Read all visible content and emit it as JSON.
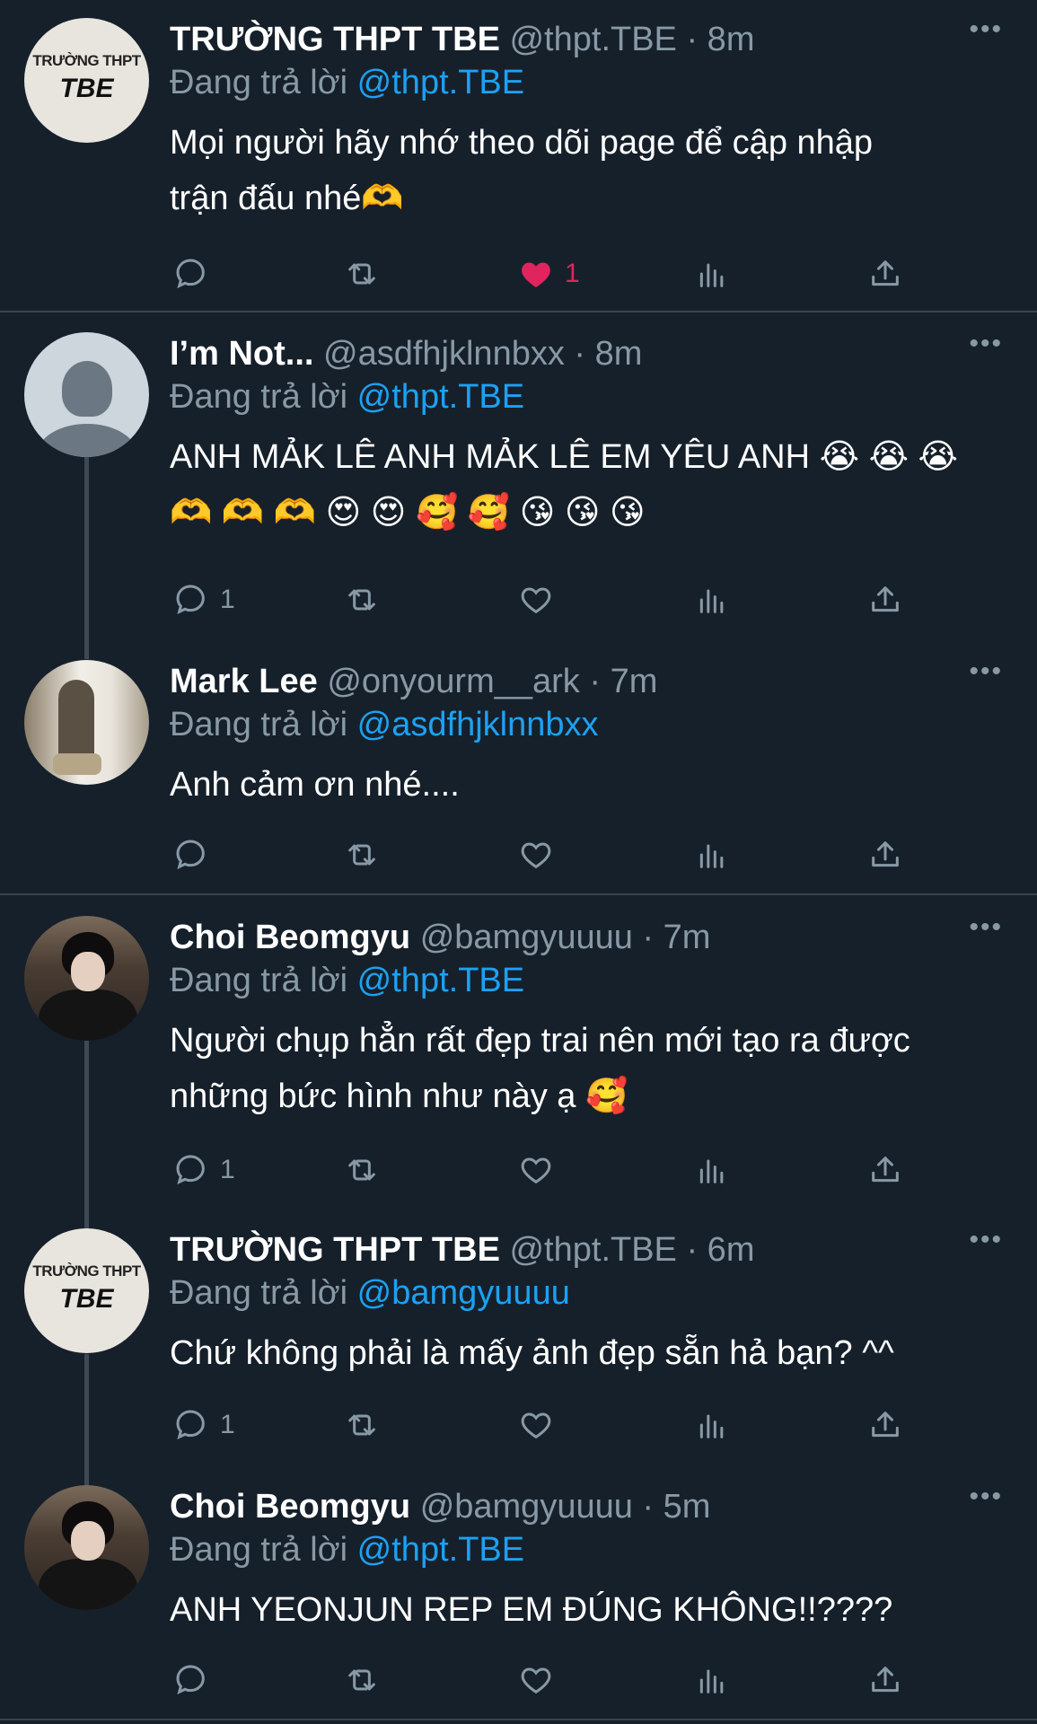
{
  "colors": {
    "background": "#16202b",
    "text": "#ffffff",
    "muted": "#8899a6",
    "link": "#1da1f2",
    "like": "#e0245e",
    "separator": "#38444d"
  },
  "tweets": [
    {
      "name": "TRƯỜNG THPT TBE",
      "handle": "@thpt.TBE",
      "time": "· 8m",
      "reply_prefix": "Đang trả lời",
      "reply_to": "@thpt.TBE",
      "line1": "Mọi người hãy nhớ theo dõi page để cập nhập",
      "line2": "trận đấu nhé🫶",
      "reply_count": "",
      "like_count": "1",
      "liked": true,
      "avatar": "school-logo",
      "avatar_text1": "TRƯỜNG THPT",
      "avatar_text2": "TBE"
    },
    {
      "name": "I’m Not...",
      "handle": "@asdfhjklnnbxx",
      "time": "· 8m",
      "reply_prefix": "Đang trả lời",
      "reply_to": "@thpt.TBE",
      "line1": "ANH MẢK LÊ ANH MẢK LÊ EM YÊU ANH 😭 😭 😭",
      "line2": "🫶 🫶 🫶 😍 😍 🥰 🥰 😘 😘 😘",
      "reply_count": "1",
      "like_count": "",
      "liked": false,
      "avatar": "default-avatar"
    },
    {
      "name": "Mark Lee",
      "handle": "@onyourm__ark",
      "time": "· 7m",
      "reply_prefix": "Đang trả lời",
      "reply_to": "@asdfhjklnnbxx",
      "line1": "Anh cảm ơn nhé....",
      "line2": "",
      "reply_count": "",
      "like_count": "",
      "liked": false,
      "avatar": "photo-avatar"
    },
    {
      "name": "Choi Beomgyu",
      "handle": "@bamgyuuuu",
      "time": "· 7m",
      "reply_prefix": "Đang trả lời",
      "reply_to": "@thpt.TBE",
      "line1": "Người chụp hẳn rất đẹp trai nên mới tạo ra được",
      "line2": "những bức hình như này ạ 🥰",
      "reply_count": "1",
      "like_count": "",
      "liked": false,
      "avatar": "photo-avatar"
    },
    {
      "name": "TRƯỜNG THPT TBE",
      "handle": "@thpt.TBE",
      "time": "· 6m",
      "reply_prefix": "Đang trả lời",
      "reply_to": "@bamgyuuuu",
      "line1": "Chứ không phải là mấy ảnh đẹp sẵn hả bạn? ^^",
      "line2": "",
      "reply_count": "1",
      "like_count": "",
      "liked": false,
      "avatar": "school-logo",
      "avatar_text1": "TRƯỜNG THPT",
      "avatar_text2": "TBE"
    },
    {
      "name": "Choi Beomgyu",
      "handle": "@bamgyuuuu",
      "time": "· 5m",
      "reply_prefix": "Đang trả lời",
      "reply_to": "@thpt.TBE",
      "line1": "ANH YEONJUN REP EM ĐÚNG KHÔNG!!????",
      "line2": "",
      "reply_count": "",
      "like_count": "",
      "liked": false,
      "avatar": "photo-avatar"
    }
  ]
}
